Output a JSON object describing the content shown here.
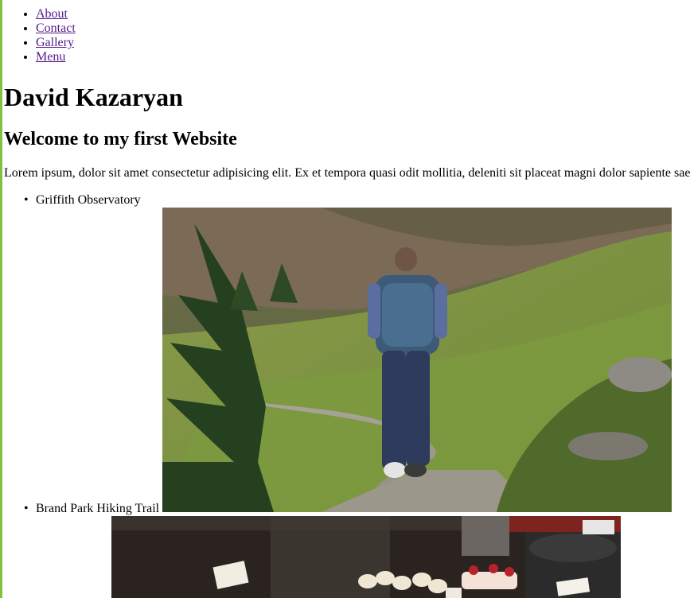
{
  "nav": {
    "items": [
      {
        "label": "About"
      },
      {
        "label": "Contact"
      },
      {
        "label": "Gallery"
      },
      {
        "label": "Menu"
      }
    ]
  },
  "header": {
    "title": "David Kazaryan",
    "welcome": "Welcome to my first Website"
  },
  "intro": {
    "text": "Lorem ipsum, dolor sit amet consectetur adipisicing elit. Ex et tempora quasi odit mollitia, deleniti sit placeat magni dolor sapiente saepe"
  },
  "places": [
    {
      "name": "Griffith Observatory"
    },
    {
      "name": "Brand Park Hiking Trail"
    }
  ],
  "colors": {
    "link": "#551a8b",
    "left_rule": "#7fc241"
  }
}
